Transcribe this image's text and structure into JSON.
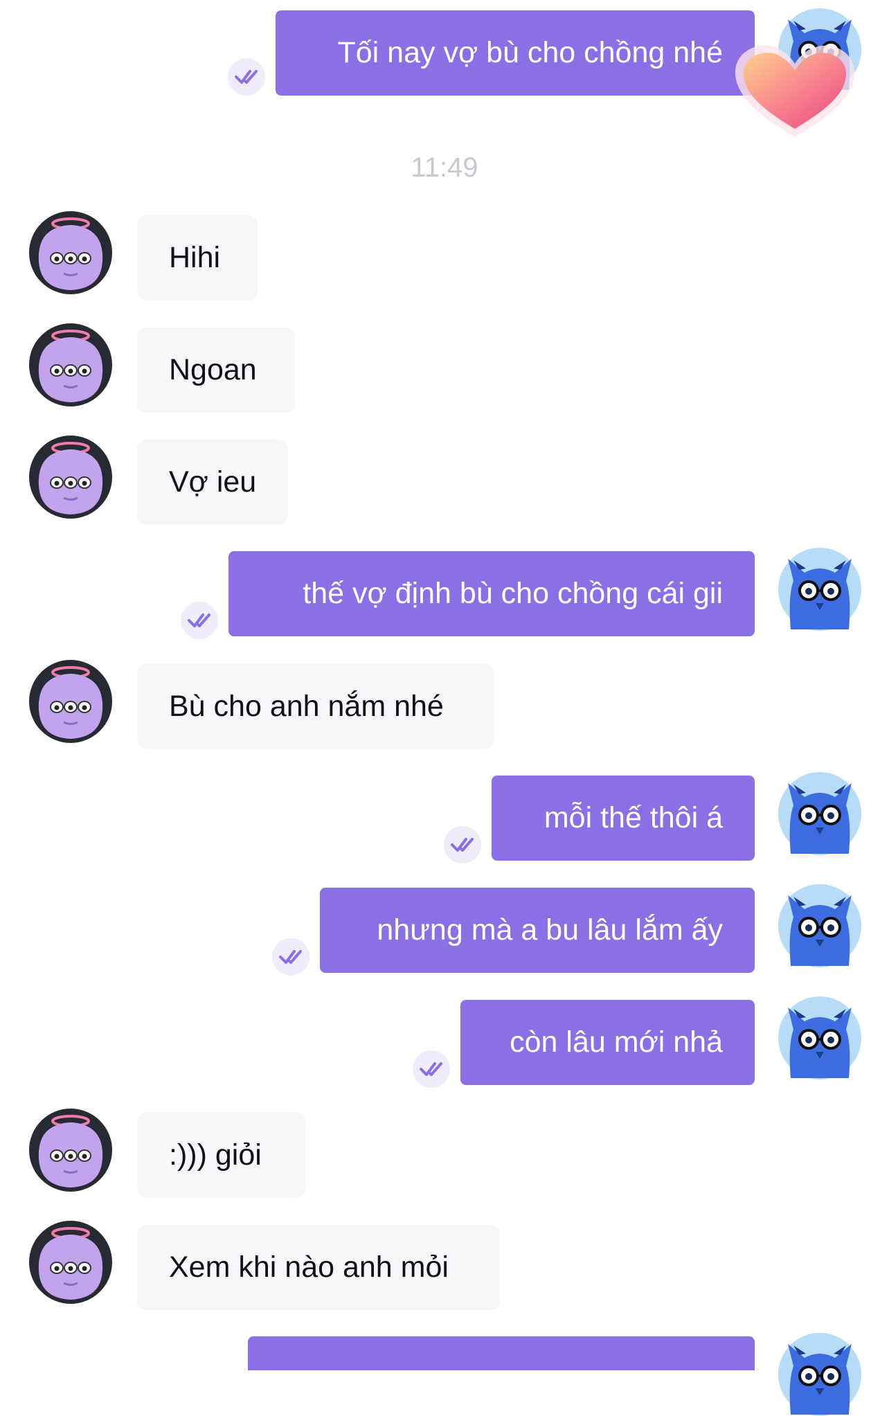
{
  "conversation": {
    "timestamp": "11:49",
    "messages": [
      {
        "side": "out",
        "text": "Tối nay vợ bù cho chồng nhé",
        "reaction": "heart"
      },
      {
        "side": "in",
        "text": "Hihi"
      },
      {
        "side": "in",
        "text": "Ngoan"
      },
      {
        "side": "in",
        "text": "Vợ ieu"
      },
      {
        "side": "out",
        "text": "thế vợ định bù cho chồng cái gii"
      },
      {
        "side": "in",
        "text": "Bù cho anh nắm nhé"
      },
      {
        "side": "out",
        "text": "mỗi thế thôi á"
      },
      {
        "side": "out",
        "text": "nhưng mà a bu lâu lắm ấy"
      },
      {
        "side": "out",
        "text": "còn lâu mới nhả"
      },
      {
        "side": "in",
        "text": ":))) giỏi"
      },
      {
        "side": "in",
        "text": "Xem khi nào anh mỏi"
      },
      {
        "side": "out",
        "text": ""
      }
    ]
  },
  "icons": {
    "seen": "double-check-icon",
    "reaction": "heart-reaction-icon",
    "avatar_self": "blue-monster-avatar",
    "avatar_partner": "purple-monster-avatar"
  },
  "colors": {
    "outgoing_bubble": "#8b6fe5",
    "incoming_bubble": "#f7f7f9",
    "timestamp": "#c8c9d0",
    "seen_check": "#8b6fe5"
  }
}
